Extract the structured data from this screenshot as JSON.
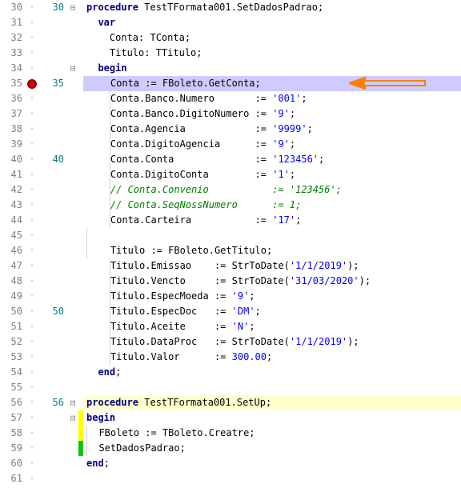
{
  "lines": [
    {
      "ln": 30,
      "fold": "⊟",
      "ln2": "30",
      "typ": "kw",
      "pfx": "",
      "txt": "procedure ",
      "tail": "TestTFormata001.SetDadosPadrao;",
      "cls": "",
      "indent": 0
    },
    {
      "ln": 31,
      "fold": "",
      "ln2": "",
      "typ": "kw",
      "pfx": "  ",
      "txt": "var",
      "tail": "",
      "cls": "",
      "indent": 0
    },
    {
      "ln": 32,
      "fold": "",
      "ln2": "",
      "typ": "id",
      "pfx": "    ",
      "txt": "Conta: TConta;",
      "tail": "",
      "cls": "",
      "indent": 0
    },
    {
      "ln": 33,
      "fold": "",
      "ln2": "",
      "typ": "id",
      "pfx": "    ",
      "txt": "Titulo: TTitulo;",
      "tail": "",
      "cls": "",
      "indent": 0
    },
    {
      "ln": 34,
      "fold": "⊟",
      "ln2": "",
      "typ": "kw",
      "pfx": "  ",
      "txt": "begin",
      "tail": "",
      "cls": "",
      "indent": 0
    },
    {
      "ln": 35,
      "fold": "",
      "ln2": "35",
      "typ": "raw",
      "raw": "    Conta := FBoleto.GetConta;",
      "cls": "hl-line",
      "bp": true,
      "arrow": true,
      "indent": 1
    },
    {
      "ln": 36,
      "fold": "",
      "ln2": "",
      "typ": "assign",
      "pfx": "    ",
      "lhs": "Conta.Banco.Numero",
      "pad": "       ",
      "rhs": "'001'",
      "cls": "",
      "indent": 1
    },
    {
      "ln": 37,
      "fold": "",
      "ln2": "",
      "typ": "assign",
      "pfx": "    ",
      "lhs": "Conta.Banco.DigitoNumero",
      "pad": " ",
      "rhs": "'9'",
      "cls": "",
      "indent": 1
    },
    {
      "ln": 38,
      "fold": "",
      "ln2": "",
      "typ": "assign",
      "pfx": "    ",
      "lhs": "Conta.Agencia",
      "pad": "            ",
      "rhs": "'9999'",
      "cls": "",
      "indent": 1
    },
    {
      "ln": 39,
      "fold": "",
      "ln2": "",
      "typ": "assign",
      "pfx": "    ",
      "lhs": "Conta.DigitoAgencia",
      "pad": "      ",
      "rhs": "'9'",
      "cls": "",
      "indent": 1
    },
    {
      "ln": 40,
      "fold": "",
      "ln2": "40",
      "typ": "assign",
      "pfx": "    ",
      "lhs": "Conta.Conta",
      "pad": "              ",
      "rhs": "'123456'",
      "cls": "",
      "indent": 1
    },
    {
      "ln": 41,
      "fold": "",
      "ln2": "",
      "typ": "assign",
      "pfx": "    ",
      "lhs": "Conta.DigitoConta",
      "pad": "        ",
      "rhs": "'1'",
      "cls": "",
      "indent": 1
    },
    {
      "ln": 42,
      "fold": "",
      "ln2": "",
      "typ": "cmt",
      "pfx": "    ",
      "txt": "// Conta.Convenio           := '123456';",
      "cls": "",
      "indent": 1
    },
    {
      "ln": 43,
      "fold": "",
      "ln2": "",
      "typ": "cmt",
      "pfx": "    ",
      "txt": "// Conta.SeqNossNumero      := 1;",
      "cls": "",
      "indent": 1
    },
    {
      "ln": 44,
      "fold": "",
      "ln2": "",
      "typ": "assign",
      "pfx": "    ",
      "lhs": "Conta.Carteira",
      "pad": "           ",
      "rhs2": "'17'",
      "cls": "",
      "indent": 1
    },
    {
      "ln": 45,
      "fold": "",
      "ln2": "",
      "typ": "blank",
      "cls": "",
      "indent": 1
    },
    {
      "ln": 46,
      "fold": "",
      "ln2": "",
      "typ": "raw",
      "raw": "    Titulo := FBoleto.GetTitulo;",
      "cls": "",
      "indent": 1
    },
    {
      "ln": 47,
      "fold": "",
      "ln2": "",
      "typ": "call",
      "pfx": "    ",
      "lhs": "Titulo.Emissao",
      "pad": "    ",
      "fn": "StrToDate",
      "arg": "'1/1/2019'",
      "cls": "",
      "indent": 1
    },
    {
      "ln": 48,
      "fold": "",
      "ln2": "",
      "typ": "call",
      "pfx": "    ",
      "lhs": "Titulo.Vencto",
      "pad": "     ",
      "fn": "StrToDate",
      "arg": "'31/03/2020'",
      "cls": "",
      "indent": 1
    },
    {
      "ln": 49,
      "fold": "",
      "ln2": "",
      "typ": "assign",
      "pfx": "    ",
      "lhs": "Titulo.EspecMoeda",
      "pad": " ",
      "rhs": "'9'",
      "cls": "",
      "indent": 1
    },
    {
      "ln": 50,
      "fold": "",
      "ln2": "50",
      "typ": "assign",
      "pfx": "    ",
      "lhs": "Titulo.EspecDoc",
      "pad": "   ",
      "rhs": "'DM'",
      "cls": "",
      "indent": 1
    },
    {
      "ln": 51,
      "fold": "",
      "ln2": "",
      "typ": "assign",
      "pfx": "    ",
      "lhs": "Titulo.Aceite",
      "pad": "     ",
      "rhs": "'N'",
      "cls": "",
      "indent": 1
    },
    {
      "ln": 52,
      "fold": "",
      "ln2": "",
      "typ": "call",
      "pfx": "    ",
      "lhs": "Titulo.DataProc",
      "pad": "   ",
      "fn": "StrToDate",
      "arg": "'1/1/2019'",
      "cls": "",
      "indent": 1
    },
    {
      "ln": 53,
      "fold": "",
      "ln2": "",
      "typ": "assignnum",
      "pfx": "    ",
      "lhs": "Titulo.Valor",
      "pad": "      ",
      "rhs": "300.00",
      "cls": "",
      "indent": 1
    },
    {
      "ln": 54,
      "fold": "",
      "ln2": "",
      "typ": "kw",
      "pfx": "  ",
      "txt": "end",
      "tail": ";",
      "cls": "",
      "indent": 0
    },
    {
      "ln": 55,
      "fold": "",
      "ln2": "",
      "typ": "blank",
      "cls": "",
      "indent": 0
    },
    {
      "ln": 56,
      "fold": "⊟",
      "ln2": "56",
      "typ": "kw",
      "pfx": "",
      "txt": "procedure ",
      "tail": "TestTFormata001.SetUp;",
      "cls": "hl-new",
      "indent": 0
    },
    {
      "ln": 57,
      "fold": "⊟",
      "ln2": "",
      "typ": "kw",
      "pfx": "",
      "txt": "begin",
      "tail": "",
      "cls": "",
      "cm": "y",
      "indent": 0
    },
    {
      "ln": 58,
      "fold": "",
      "ln2": "",
      "typ": "raw",
      "raw": "  FBoleto := TBoleto.Creatre;",
      "cls": "",
      "cm": "y",
      "indent": 1
    },
    {
      "ln": 59,
      "fold": "",
      "ln2": "",
      "typ": "raw",
      "raw": "  SetDadosPadrao;",
      "cls": "",
      "cm": "g",
      "indent": 1
    },
    {
      "ln": 60,
      "fold": "",
      "ln2": "",
      "typ": "kw",
      "pfx": "",
      "txt": "end",
      "tail": ";",
      "cls": "",
      "indent": 0
    },
    {
      "ln": 61,
      "fold": "",
      "ln2": "",
      "typ": "blank",
      "cls": "",
      "indent": 0
    }
  ],
  "icons": {
    "fold_open": "⊟"
  }
}
